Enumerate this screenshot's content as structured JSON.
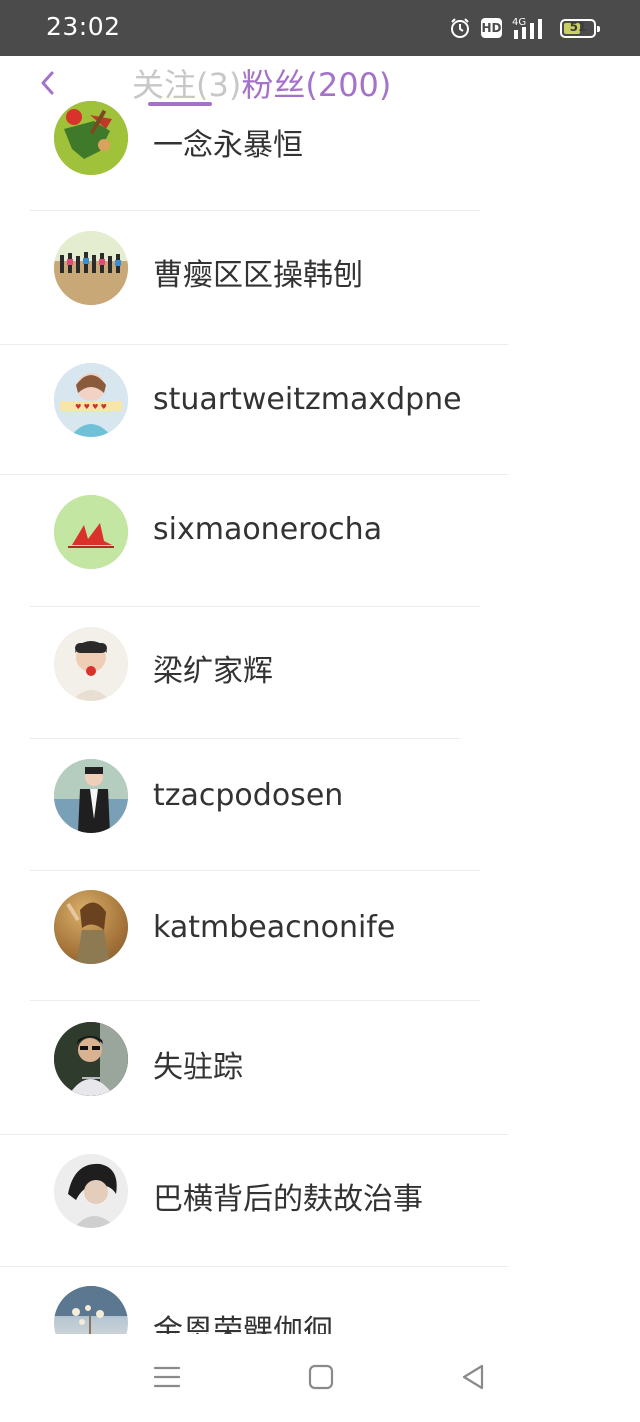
{
  "status_bar": {
    "time": "23:02",
    "hd": "HD",
    "network": "4G",
    "battery": "51"
  },
  "header": {
    "tabs": [
      {
        "label": "关注(3)",
        "active": false
      },
      {
        "label": "粉丝(200)",
        "active": true
      }
    ],
    "accent_color": "#a572c9"
  },
  "fans": [
    {
      "name": "一念永暴恒",
      "avatar": "cartoon-archer-avatar"
    },
    {
      "name": "曹瘿区区操韩刨",
      "avatar": "group-beach-avatar"
    },
    {
      "name": "stuartweitzmaxdpne",
      "avatar": "girl-banner-avatar"
    },
    {
      "name": "sixmaonerocha",
      "avatar": "red-cranes-avatar"
    },
    {
      "name": "梁纩家辉",
      "avatar": "boy-flower-avatar"
    },
    {
      "name": "tzacpodosen",
      "avatar": "man-suit-avatar"
    },
    {
      "name": "katmbeacnonife",
      "avatar": "woman-sunset-avatar"
    },
    {
      "name": "失驻踪",
      "avatar": "man-sunglasses-avatar"
    },
    {
      "name": "巴横背后的麸故治事",
      "avatar": "woman-dark-avatar"
    },
    {
      "name": "金恩荣髁伽徊",
      "avatar": "blossom-avatar"
    }
  ],
  "nav": [
    "menu-icon",
    "home-icon",
    "back-triangle-icon"
  ]
}
